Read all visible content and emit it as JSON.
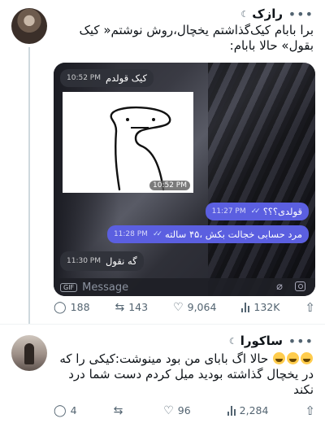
{
  "tweet1": {
    "username": "رازک",
    "moon_icon": "crescent-moon-icon",
    "text": "برا بابام کیک‌گذاشتم یخچال،روش نوشتم« کیک بقول» حالا بابام:",
    "media": {
      "bubble1": {
        "text": "کیک قولدم",
        "time": "10:52 PM"
      },
      "sticker_time": "10:52 PM",
      "bubble2": {
        "text": "قولدی؟؟؟",
        "time": "11:27 PM"
      },
      "bubble3": {
        "text": "مرد حسابی خجالت بکش ،۴۵ سالته",
        "time": "11:28 PM"
      },
      "bubble4": {
        "text": "گه نقول",
        "time": "11:30 PM"
      },
      "gif_label": "GIF",
      "message_placeholder": "Message"
    },
    "actions": {
      "replies": "188",
      "retweets": "143",
      "likes": "9,064",
      "views": "132K"
    }
  },
  "tweet2": {
    "username": "ساکورا",
    "moon_icon": "crescent-moon-icon",
    "text_main": "حالا اگ بابای من بود مینوشت:کیکی را که در یخچال گذاشته بودید میل کردم دست شما درد نکند",
    "emoji_icons": [
      "joy-emoji-icon",
      "joy-emoji-icon",
      "joy-emoji-icon"
    ],
    "actions": {
      "replies": "4",
      "retweets": "",
      "likes": "96",
      "views": "2,284"
    }
  },
  "colors": {
    "accent_out": "#5b5fe0",
    "muted": "#536471",
    "thread_line": "#cfd9de"
  }
}
